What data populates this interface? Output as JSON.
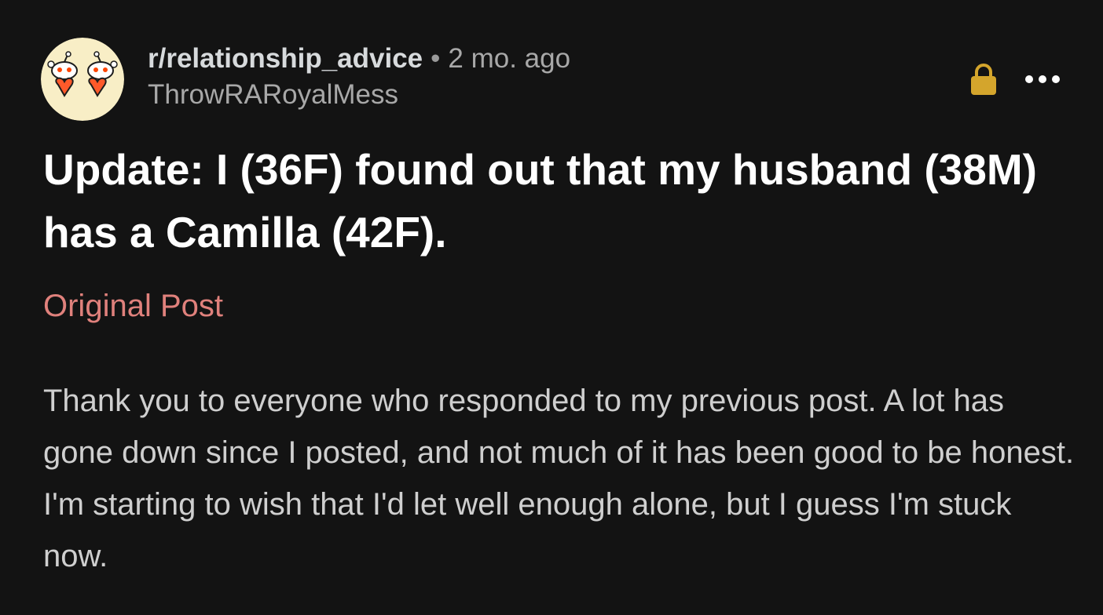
{
  "post": {
    "subreddit": "r/relationship_advice",
    "separator": "•",
    "time": "2 mo. ago",
    "username": "ThrowRARoyalMess",
    "title": "Update: I (36F) found out that my husband (38M) has a Camilla (42F).",
    "link_label": "Original Post",
    "body": "Thank you to everyone who responded to my previous post. A lot has gone down since I posted, and not much of it has been good to be honest. I'm starting to wish that I'd let well enough alone, but I guess I'm stuck now."
  },
  "icons": {
    "avatar": "subreddit-avatar",
    "lock": "lock-icon",
    "more": "more-options-icon"
  },
  "colors": {
    "background": "#131313",
    "title": "#ffffff",
    "body": "#cfcfcf",
    "link": "#e0817c",
    "lock": "#d4a52c",
    "avatar_bg": "#f8eec6"
  }
}
